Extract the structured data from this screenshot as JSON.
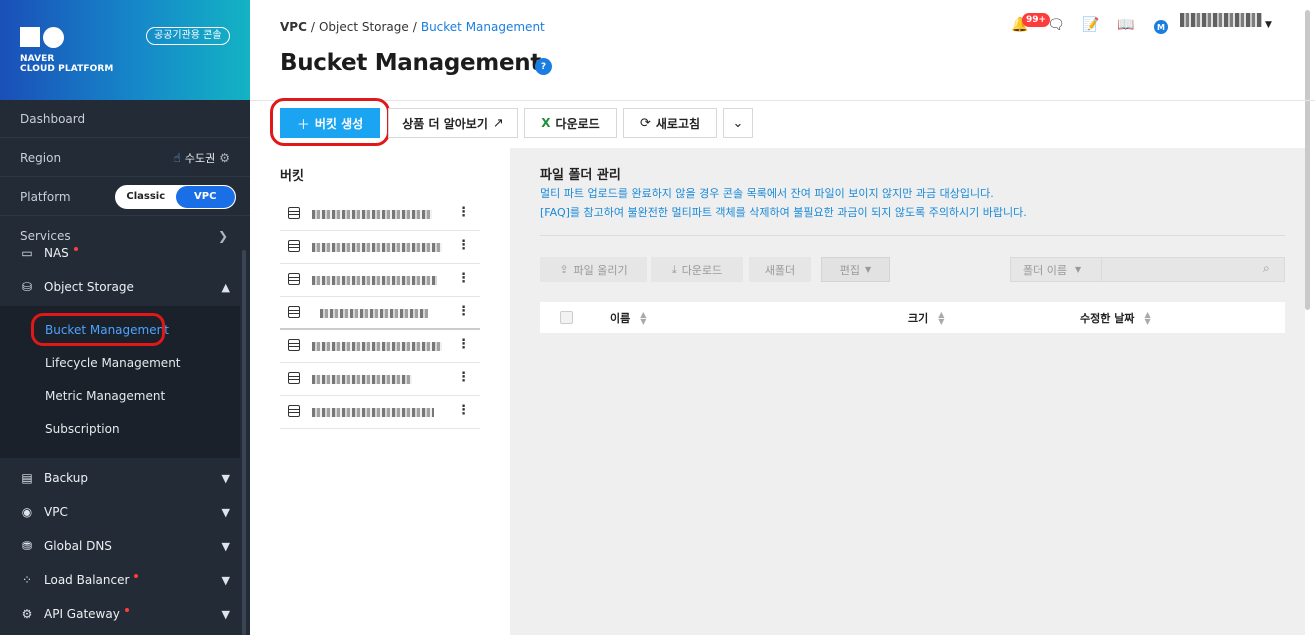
{
  "brand": {
    "line1": "NAVER",
    "line2": "CLOUD PLATFORM",
    "gov_badge": "공공기관용 콘솔"
  },
  "sidebar": {
    "dashboard": "Dashboard",
    "region_label": "Region",
    "region_value": "수도권",
    "platform_label": "Platform",
    "platform_classic": "Classic",
    "platform_vpc": "VPC",
    "services": "Services",
    "items": [
      {
        "label": "NAS"
      },
      {
        "label": "Object Storage"
      },
      {
        "label": "Backup"
      },
      {
        "label": "VPC"
      },
      {
        "label": "Global DNS"
      },
      {
        "label": "Load Balancer"
      },
      {
        "label": "API Gateway"
      }
    ],
    "sub_items": [
      {
        "label": "Bucket Management"
      },
      {
        "label": "Lifecycle Management"
      },
      {
        "label": "Metric Management"
      },
      {
        "label": "Subscription"
      }
    ]
  },
  "breadcrumb": {
    "b1": "VPC",
    "b2": "Object Storage",
    "b3": "Bucket Management",
    "sep": "/"
  },
  "header": {
    "title": "Bucket Management",
    "help": "?",
    "notif_count": "99+",
    "avatar": "M"
  },
  "toolbar": {
    "create": "버킷 생성",
    "learn_more": "상품 더 알아보기",
    "download": "다운로드",
    "refresh": "새로고침"
  },
  "bucket_panel": {
    "title": "버킷"
  },
  "file_panel": {
    "title": "파일 폴더 관리",
    "note1": "멀티 파트 업로드를 완료하지 않을 경우 콘솔 목록에서 잔여 파일이 보이지 않지만 과금 대상입니다.",
    "note2": "[FAQ]를 참고하여 불완전한 멀티파트 객체를 삭제하여 불필요한 과금이 되지 않도록 주의하시기 바랍니다.",
    "upload": "파일 올리기",
    "download": "다운로드",
    "new_folder": "새폴더",
    "edit": "편집",
    "folder_select": "폴더 이름",
    "search_placeholder": "",
    "columns": {
      "name": "이름",
      "size": "크기",
      "modified": "수정한 날짜"
    }
  },
  "colors": {
    "primary": "#1ba4f2",
    "sidebar_bg": "#222b36",
    "link": "#1a7ee0",
    "highlight": "#e01818"
  }
}
